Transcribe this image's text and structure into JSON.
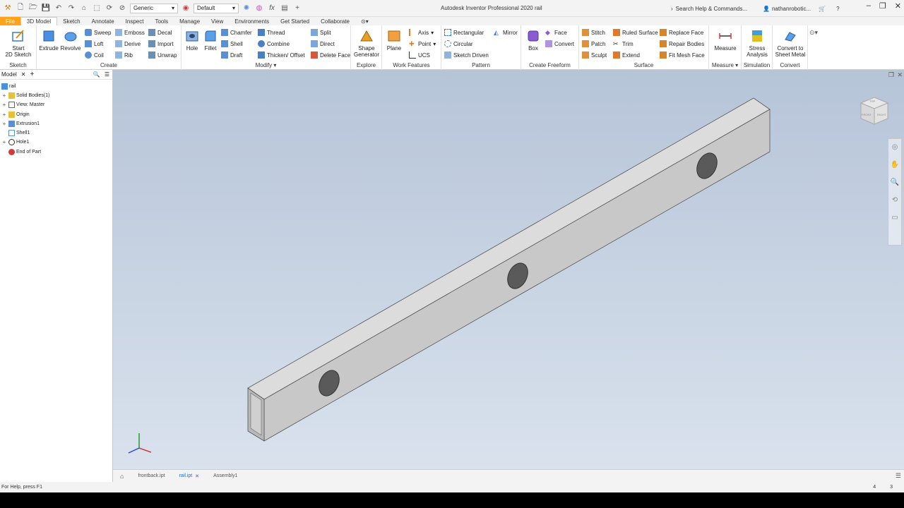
{
  "titlebar": {
    "appearance_value": "Generic",
    "material_value": "Default",
    "title": "Autodesk Inventor Professional 2020   rail",
    "search_placeholder": "Search Help & Commands...",
    "user": "nathanrobotic..."
  },
  "tabs": [
    "File",
    "3D Model",
    "Sketch",
    "Annotate",
    "Inspect",
    "Tools",
    "Manage",
    "View",
    "Environments",
    "Get Started",
    "Collaborate"
  ],
  "ribbon": {
    "sketch": {
      "start_label": "Start\n2D Sketch",
      "panel": "Sketch"
    },
    "create": {
      "extrude": "Extrude",
      "revolve": "Revolve",
      "sweep": "Sweep",
      "emboss": "Emboss",
      "decal": "Decal",
      "loft": "Loft",
      "derive": "Derive",
      "import": "Import",
      "coil": "Coil",
      "rib": "Rib",
      "unwrap": "Unwrap",
      "panel": "Create"
    },
    "modify": {
      "hole": "Hole",
      "fillet": "Fillet",
      "chamfer": "Chamfer",
      "thread": "Thread",
      "split": "Split",
      "shell": "Shell",
      "combine": "Combine",
      "direct": "Direct",
      "draft": "Draft",
      "thicken": "Thicken/ Offset",
      "delete_face": "Delete Face",
      "panel": "Modify"
    },
    "explore": {
      "shape_gen": "Shape\nGenerator",
      "panel": "Explore"
    },
    "work": {
      "plane": "Plane",
      "axis": "Axis",
      "point": "Point",
      "ucs": "UCS",
      "panel": "Work Features"
    },
    "pattern": {
      "rectangular": "Rectangular",
      "mirror": "Mirror",
      "circular": "Circular",
      "sketch_driven": "Sketch Driven",
      "panel": "Pattern"
    },
    "freeform": {
      "box": "Box",
      "face": "Face",
      "convert": "Convert",
      "panel": "Create Freeform"
    },
    "surface": {
      "stitch": "Stitch",
      "ruled": "Ruled Surface",
      "replace": "Replace Face",
      "patch": "Patch",
      "trim": "Trim",
      "repair": "Repair Bodies",
      "sculpt": "Sculpt",
      "extend": "Extend",
      "fit_mesh": "Fit Mesh Face",
      "panel": "Surface"
    },
    "measure": {
      "label": "Measure",
      "panel": "Measure"
    },
    "simulation": {
      "label": "Stress\nAnalysis",
      "panel": "Simulation"
    },
    "convert": {
      "label": "Convert to\nSheet Metal",
      "panel": "Convert"
    }
  },
  "browser": {
    "title": "Model",
    "root": "rail",
    "items": [
      "Solid Bodies(1)",
      "View: Master",
      "Origin",
      "Extrusion1",
      "Shell1",
      "Hole1",
      "End of Part"
    ]
  },
  "viewcube": {
    "front": "FRONT",
    "right": "RIGHT",
    "top": "TOP"
  },
  "doc_tabs": [
    "frontback.ipt",
    "rail.ipt",
    "Assembly1"
  ],
  "status": {
    "help": "For Help, press F1",
    "num1": "4",
    "num2": "3"
  }
}
